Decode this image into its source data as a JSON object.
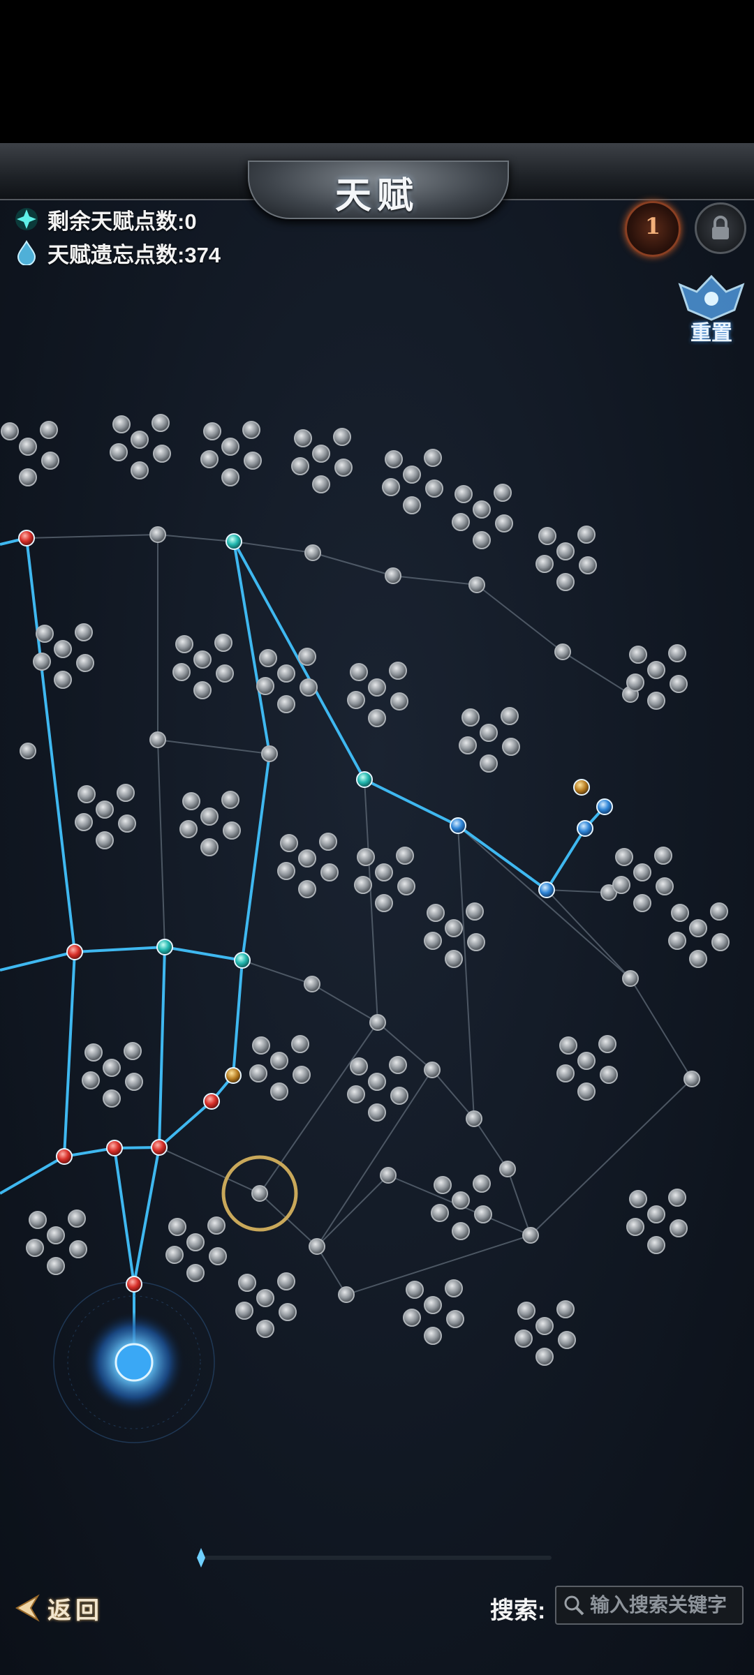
{
  "header": {
    "title": "天赋"
  },
  "stats": {
    "remaining_label": "剩余天赋点数:0",
    "forget_label": "天赋遗忘点数:374"
  },
  "buttons": {
    "ring_number": "1",
    "reset_label": "重置",
    "back_label": "返回"
  },
  "search": {
    "label": "搜索:",
    "placeholder": "输入搜索关键字"
  },
  "colors": {
    "active_line": "#3fb8f0",
    "inactive_line": "#5b6673",
    "selected_ring": "#c9a85a"
  },
  "icons": [
    "crystal-icon",
    "water-drop-icon",
    "ring-icon",
    "lock-icon",
    "reset-wings-icon",
    "back-arrow-icon",
    "search-icon"
  ]
}
